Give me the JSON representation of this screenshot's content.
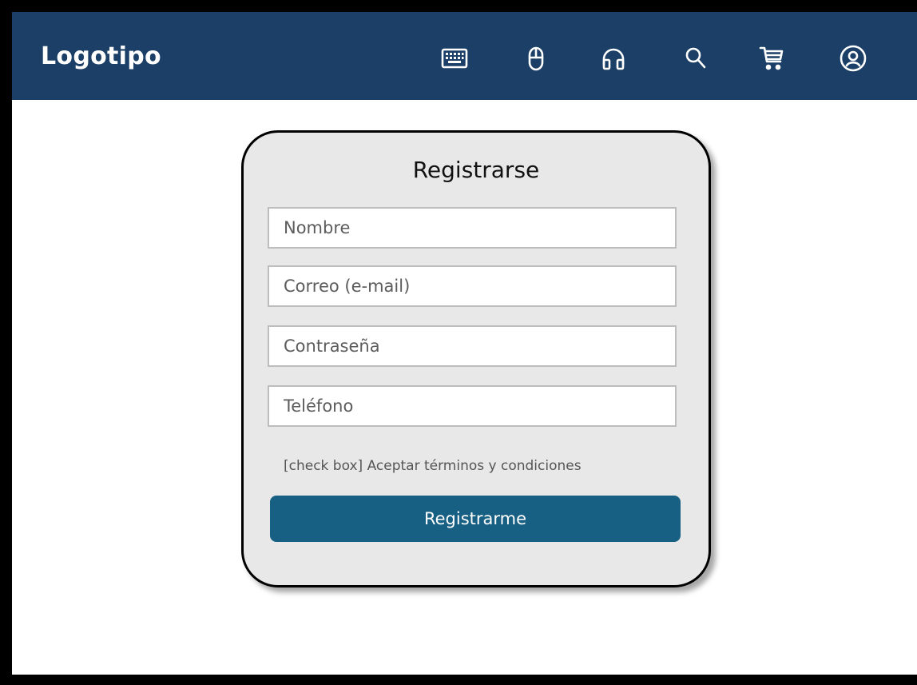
{
  "header": {
    "logo": "Logotipo",
    "icons": [
      "keyboard-icon",
      "mouse-icon",
      "headphones-icon",
      "search-icon",
      "cart-icon",
      "user-icon"
    ],
    "background": "#1b3f66"
  },
  "form": {
    "title": "Registrarse",
    "fields": {
      "name_placeholder": "Nombre",
      "email_placeholder": "Correo (e-mail)",
      "password_placeholder": "Contraseña",
      "phone_placeholder": "Teléfono"
    },
    "terms_label": "[check box] Aceptar términos y condiciones",
    "submit_label": "Registrarme",
    "button_color": "#186083",
    "card_background": "#e8e8e9"
  }
}
